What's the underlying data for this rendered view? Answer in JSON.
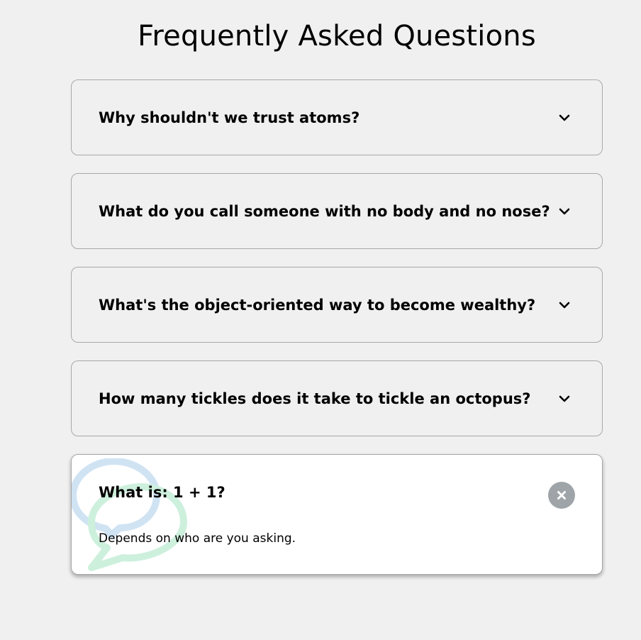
{
  "page": {
    "title": "Frequently Asked Questions"
  },
  "faqs": [
    {
      "question": "Why shouldn't we trust atoms?",
      "answer": "",
      "toggle_icon": "chevron-down-icon",
      "expanded": false
    },
    {
      "question": "What do you call someone with no body and no nose?",
      "answer": "",
      "toggle_icon": "chevron-down-icon",
      "expanded": false
    },
    {
      "question": "What's the object-oriented way to become wealthy?",
      "answer": "",
      "toggle_icon": "chevron-down-icon",
      "expanded": false
    },
    {
      "question": "How many tickles does it take to tickle an octopus?",
      "answer": "",
      "toggle_icon": "chevron-down-icon",
      "expanded": false
    },
    {
      "question": "What is: 1 + 1?",
      "answer": "Depends on who are you asking.",
      "toggle_icon": "close-icon",
      "expanded": true
    }
  ],
  "colors": {
    "background": "#f0f0f0",
    "card_active": "#ffffff",
    "card_border": "#a8a8a8",
    "close_button": "#9fa4a8",
    "bubble_blue": "#cfe3f3",
    "bubble_green": "#cdf0dd"
  }
}
